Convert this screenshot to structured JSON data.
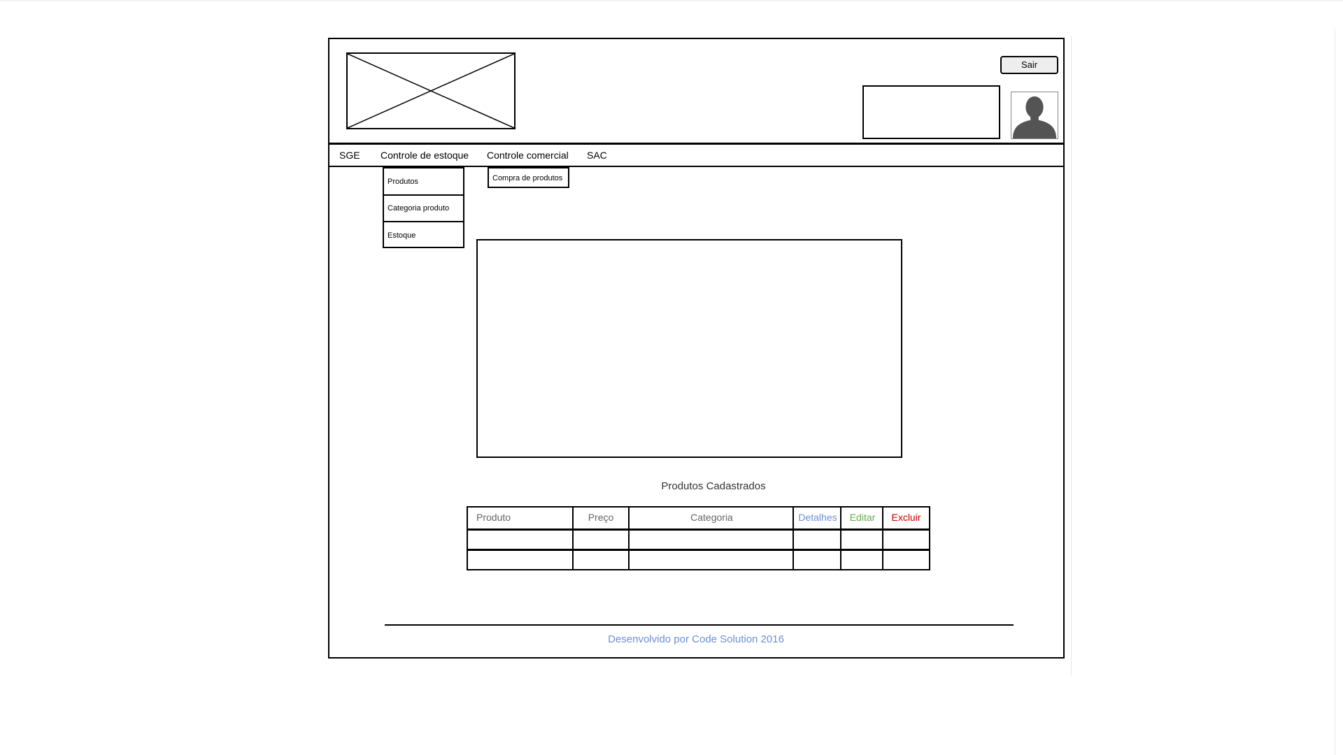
{
  "header": {
    "logout_label": "Sair"
  },
  "nav": {
    "items": [
      "SGE",
      "Controle de estoque",
      "Controle comercial",
      "SAC"
    ]
  },
  "estoque_menu": {
    "items": [
      "Produtos",
      "Categoria produto",
      "Estoque"
    ]
  },
  "comercial_menu": {
    "items": [
      "Compra de produtos"
    ]
  },
  "products": {
    "title": "Produtos Cadastrados",
    "columns": [
      "Produto",
      "Preço",
      "Categoria",
      "Detalhes",
      "Editar",
      "Excluir"
    ],
    "column_colors": [
      "#666666",
      "#666666",
      "#666666",
      "#6d8fd6",
      "#6aa84f",
      "#cc0000"
    ],
    "rows": [
      [
        "",
        "",
        "",
        "",
        "",
        ""
      ],
      [
        "",
        "",
        "",
        "",
        "",
        ""
      ]
    ]
  },
  "footer": {
    "text": "Desenvolvido por Code Solution 2016"
  }
}
